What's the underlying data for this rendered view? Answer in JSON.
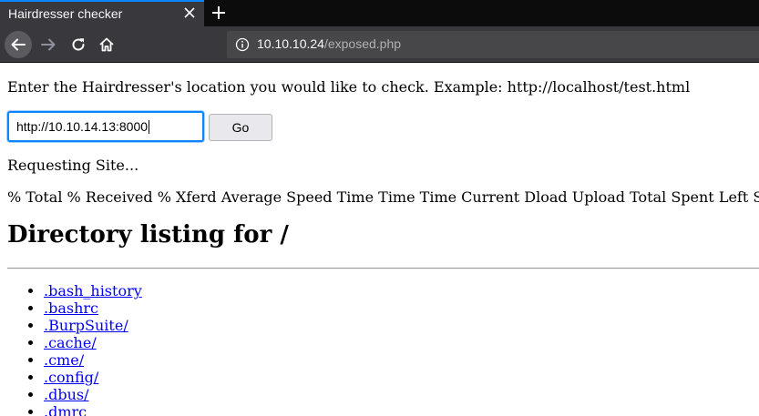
{
  "browser": {
    "tab": {
      "title": "Hairdresser checker"
    },
    "url": {
      "host": "10.10.10.24",
      "path": "/exposed.php"
    }
  },
  "page": {
    "prompt": "Enter the Hairdresser's location you would like to check. Example: http://localhost/test.html",
    "input_value": "http://10.10.14.13:8000",
    "go_label": "Go",
    "status": "Requesting Site...",
    "curl_header": "% Total % Received % Xferd Average Speed Time Time Time Current Dload Upload Total Spent Left Speed",
    "heading": "Directory listing for /",
    "files": [
      ".bash_history",
      ".bashrc",
      ".BurpSuite/",
      ".cache/",
      ".cme/",
      ".config/",
      ".dbus/",
      ".dmrc"
    ]
  },
  "icons": {
    "tab_close": "close-icon",
    "new_tab": "plus-icon",
    "back": "back-arrow-icon",
    "forward": "forward-arrow-icon",
    "reload": "reload-icon",
    "home": "home-icon",
    "site_info": "info-icon"
  },
  "colors": {
    "chrome_dark": "#0c0c0d",
    "chrome": "#38383d",
    "accent": "#0a84ff",
    "link": "#0000ee"
  }
}
